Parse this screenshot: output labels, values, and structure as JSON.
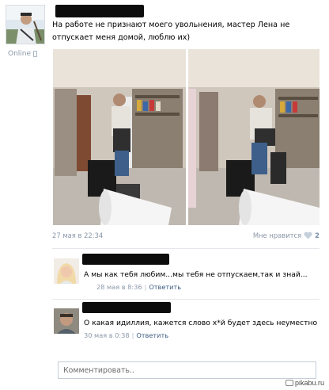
{
  "author": {
    "status": "Online"
  },
  "post": {
    "text": "На работе не признают моего увольнения, мастер Лена не отпускает меня домой, люблю их)",
    "date": "27 мая в 22:34",
    "like_label": "Мне нравится",
    "like_count": "2"
  },
  "comments": [
    {
      "text": "А мы как тебя любим...мы тебя не отпускаем,так и знай...",
      "date": "28 мая в 8:36",
      "reply_label": "Ответить"
    },
    {
      "text": "О какая идиллия, кажется слово х*й будет здесь неуместно",
      "date": "30 мая в 0:38",
      "reply_label": "Ответить"
    }
  ],
  "compose": {
    "placeholder": "Комментировать.."
  },
  "watermark": {
    "text": "pikabu.ru"
  },
  "colors": {
    "link": "#3b5b83",
    "meta": "#8a98a8",
    "redaction": "#0c0c0c"
  }
}
